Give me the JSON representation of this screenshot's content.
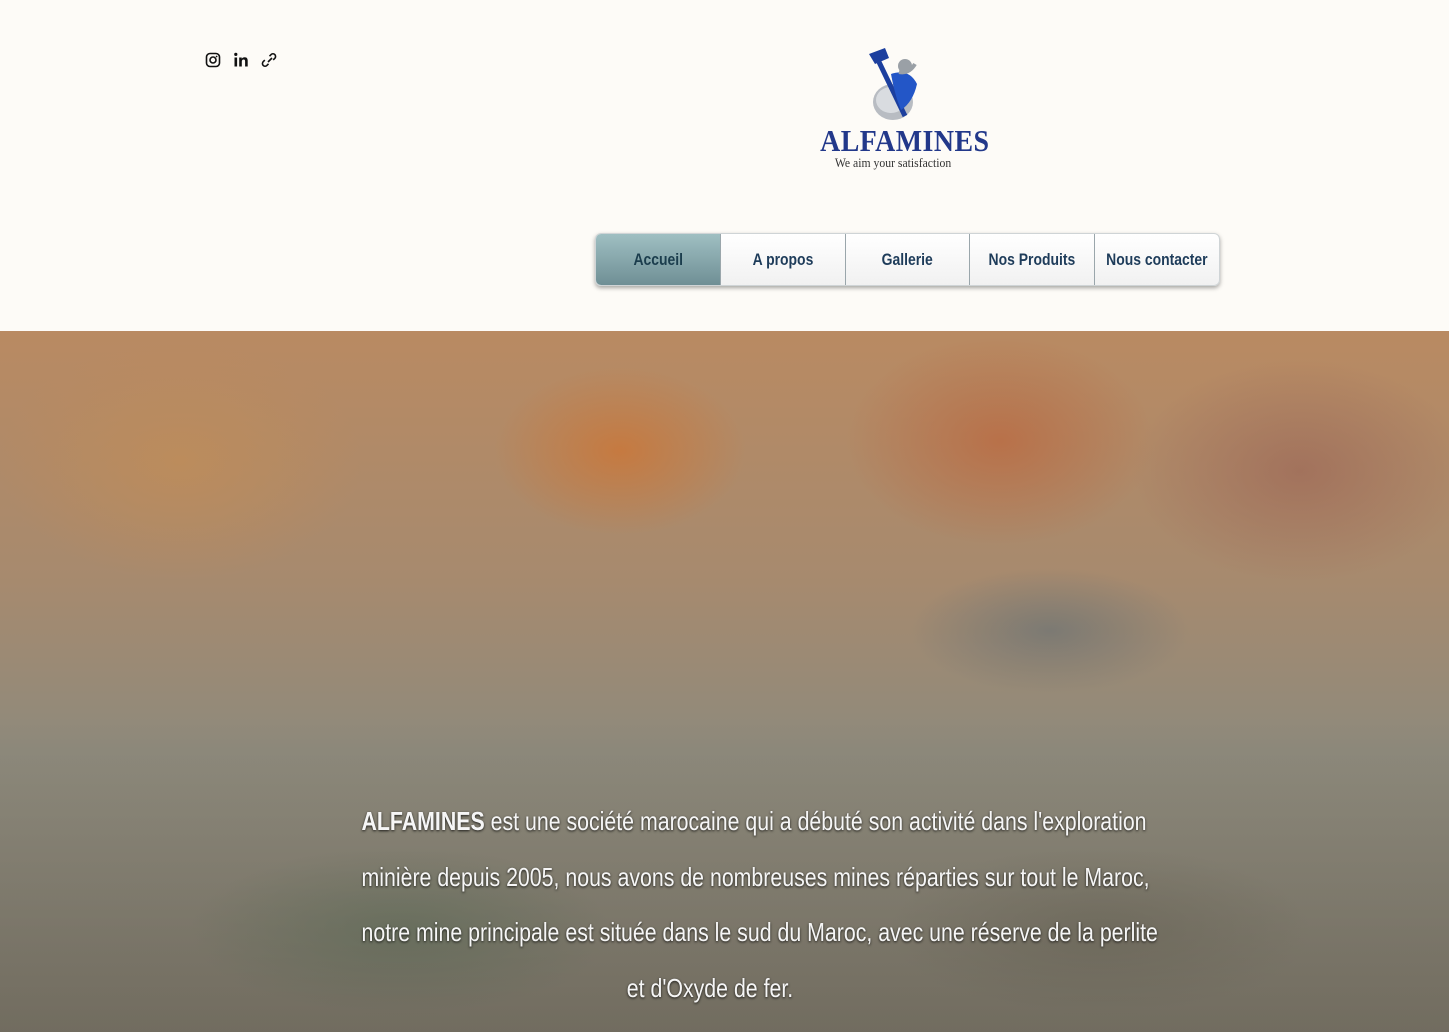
{
  "social": [
    {
      "icon": "instagram-icon"
    },
    {
      "icon": "linkedin-icon"
    },
    {
      "icon": "link-icon"
    }
  ],
  "logo": {
    "brand": "ALFAMINES",
    "tagline": "We aim your satisfaction",
    "colors": {
      "blue": "#1c3f9e",
      "silver": "#9aa0a6"
    }
  },
  "nav": {
    "items": [
      {
        "label": "Accueil",
        "active": true
      },
      {
        "label": "A propos"
      },
      {
        "label": "Gallerie"
      },
      {
        "label": "Nos Produits"
      },
      {
        "label": "Nous contacter"
      }
    ]
  },
  "hero": {
    "brand_bold": "ALFAMINES",
    "line1_rest": " est une société marocaine qui a débuté son activité dans l'exploration",
    "line2": "minière depuis 2005, nous avons de nombreuses mines réparties sur tout le Maroc,",
    "line3": "notre mine principale est située dans le sud du Maroc, avec une réserve de la perlite",
    "line4": "et  d'Oxyde de fer."
  }
}
